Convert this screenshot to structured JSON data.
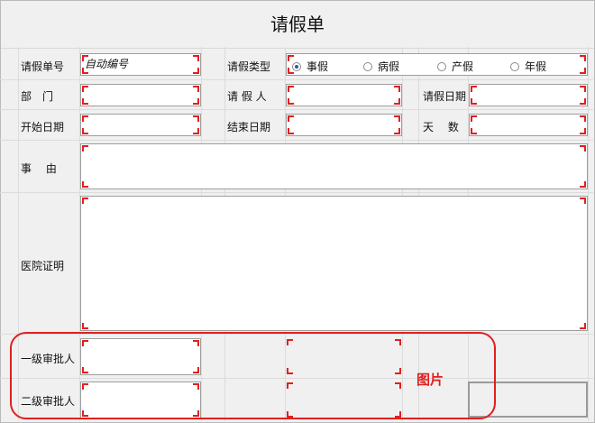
{
  "title": "请假单",
  "row1": {
    "id_label": "请假单号",
    "id_value": "自动编号",
    "type_label": "请假类型",
    "types": [
      {
        "label": "事假",
        "selected": true
      },
      {
        "label": "病假",
        "selected": false
      },
      {
        "label": "产假",
        "selected": false
      },
      {
        "label": "年假",
        "selected": false
      }
    ]
  },
  "row2": {
    "dept_label": "部　门",
    "person_label": "请 假 人",
    "date_label": "请假日期"
  },
  "row3": {
    "start_label": "开始日期",
    "end_label": "结束日期",
    "days_label": "天　 数"
  },
  "reason_label": "事　 由",
  "proof_label": "医院证明",
  "approver1_label": "一级审批人",
  "approver2_label": "二级审批人",
  "annotation": {
    "text": "图片",
    "color": "#e02020"
  }
}
